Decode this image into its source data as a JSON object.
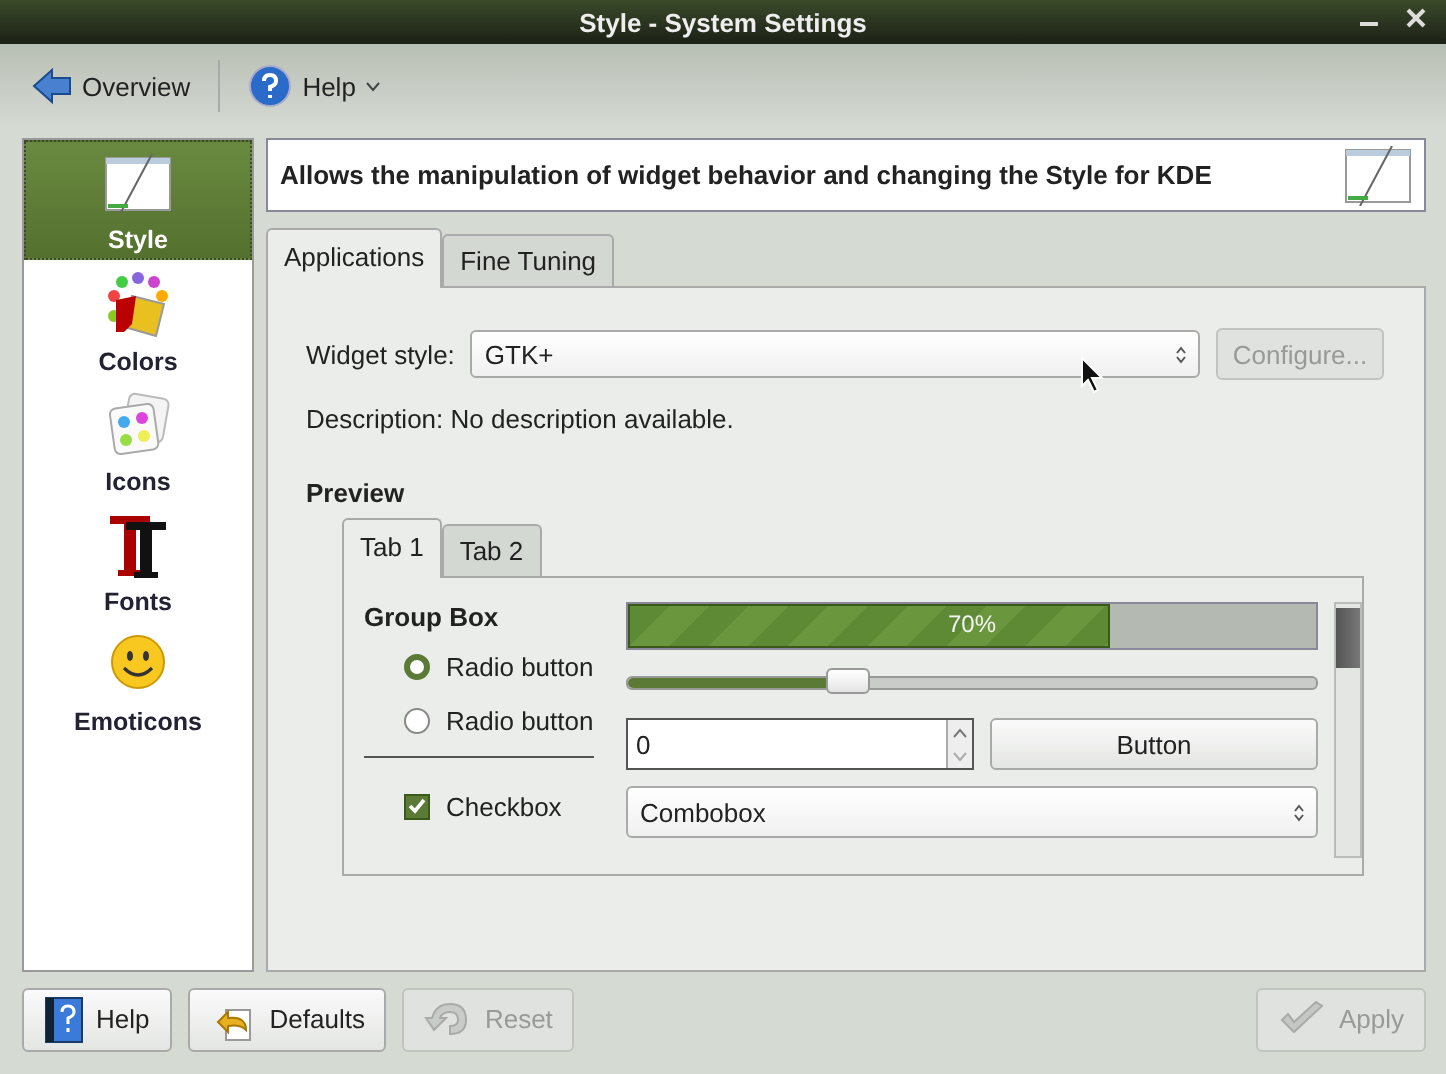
{
  "window": {
    "title": "Style - System Settings"
  },
  "toolbar": [
    {
      "kind": "back",
      "label": "Overview"
    },
    {
      "kind": "help",
      "label": "Help",
      "dropdown": true
    }
  ],
  "sidebar": {
    "items": [
      {
        "kind": "style",
        "label": "Style",
        "selected": true
      },
      {
        "kind": "colors",
        "label": "Colors",
        "selected": false
      },
      {
        "kind": "icons",
        "label": "Icons",
        "selected": false
      },
      {
        "kind": "fonts",
        "label": "Fonts",
        "selected": false
      },
      {
        "kind": "emoticons",
        "label": "Emoticons",
        "selected": false
      }
    ]
  },
  "header": {
    "text": "Allows the manipulation of widget behavior and changing the Style for KDE"
  },
  "tabs": [
    {
      "label": "Applications",
      "selected": true
    },
    {
      "label": "Fine Tuning",
      "selected": false
    }
  ],
  "widget_style": {
    "label": "Widget style:",
    "value": "GTK+",
    "configure": {
      "label": "Configure...",
      "disabled": true
    }
  },
  "description": "Description: No description available.",
  "preview": {
    "title": "Preview",
    "tabs": [
      {
        "label": "Tab 1",
        "selected": true
      },
      {
        "label": "Tab 2",
        "selected": false
      }
    ],
    "group_box": {
      "title": "Group Box",
      "radios": [
        {
          "label": "Radio button",
          "selected": true
        },
        {
          "label": "Radio button",
          "selected": false
        }
      ],
      "checkbox": {
        "label": "Checkbox",
        "checked": true
      }
    },
    "progress": {
      "level": 0.7,
      "reading": "70%"
    },
    "slider": {
      "level": 0.32
    },
    "spinbox": {
      "value": "0"
    },
    "button": {
      "label": "Button"
    },
    "combobox": {
      "value": "Combobox"
    }
  },
  "buttons": [
    {
      "kind": "help",
      "label": "Help",
      "disabled": false
    },
    {
      "kind": "defaults",
      "label": "Defaults",
      "disabled": false
    },
    {
      "kind": "reset",
      "label": "Reset",
      "disabled": true
    },
    {
      "kind": "apply",
      "label": "Apply",
      "disabled": true
    }
  ]
}
